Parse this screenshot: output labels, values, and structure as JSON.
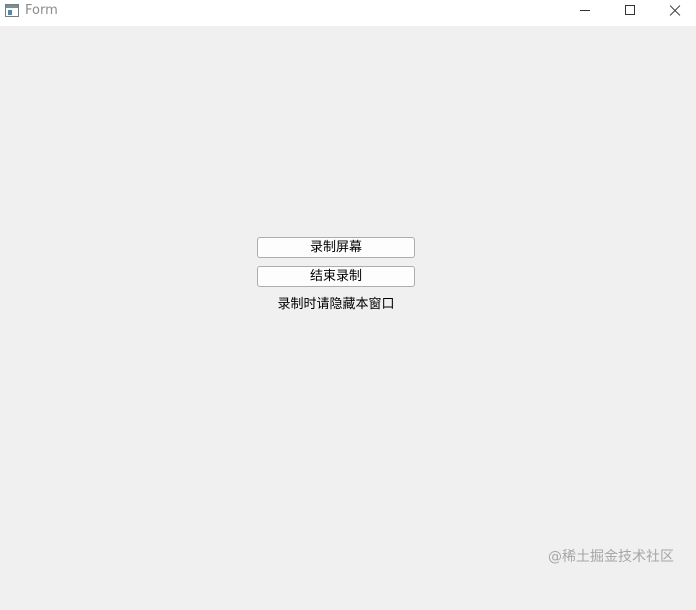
{
  "window": {
    "title": "Form",
    "controls": {
      "minimize_icon": "minimize-icon",
      "maximize_icon": "maximize-icon",
      "close_icon": "close-icon"
    }
  },
  "main": {
    "record_button_label": "录制屏幕",
    "stop_button_label": "结束录制",
    "hint_text": "录制时请隐藏本窗口"
  },
  "watermark": {
    "text": "@稀土掘金技术社区"
  },
  "colors": {
    "window_background": "#f0f0f0",
    "titlebar_background": "#ffffff",
    "button_background": "#fdfdfd",
    "button_border": "#adadad"
  }
}
